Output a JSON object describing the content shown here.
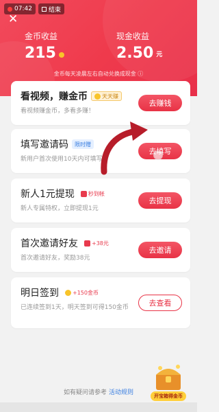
{
  "status": {
    "time": "07:42",
    "stop_label": "结束"
  },
  "header": {
    "coin_label": "金币收益",
    "coin_value": "215",
    "cash_label": "现金收益",
    "cash_value": "2.50",
    "cash_unit": "元",
    "note": "金币每天凌晨左右自动兑换成现金 ⓘ"
  },
  "tasks": [
    {
      "title": "看视频，赚金币",
      "tag": "天天赚",
      "sub": "看视频赚金币，多看多赚！",
      "button": "去赚钱"
    },
    {
      "title": "填写邀请码",
      "tag": "限时赠",
      "sub": "新用户首次使用10天内可填写",
      "button": "去填写"
    },
    {
      "title": "新人1元提现",
      "tag": "秒到帐",
      "sub": "新人专属特权，立即提现1元",
      "button": "去提现"
    },
    {
      "title": "首次邀请好友",
      "tag": "+38元",
      "sub": "首次邀请好友，奖励38元",
      "button": "去邀请"
    },
    {
      "title": "明日签到",
      "tag": "+150金币",
      "sub": "已连续签到1天，明天签到可得150金币",
      "button": "去查看"
    }
  ],
  "footer": {
    "help_prefix": "如有疑问请参考",
    "help_link": "活动规则",
    "treasure_label": "开宝箱得金币"
  },
  "colors": {
    "accent": "#e83346",
    "coin": "#f8c42a"
  }
}
